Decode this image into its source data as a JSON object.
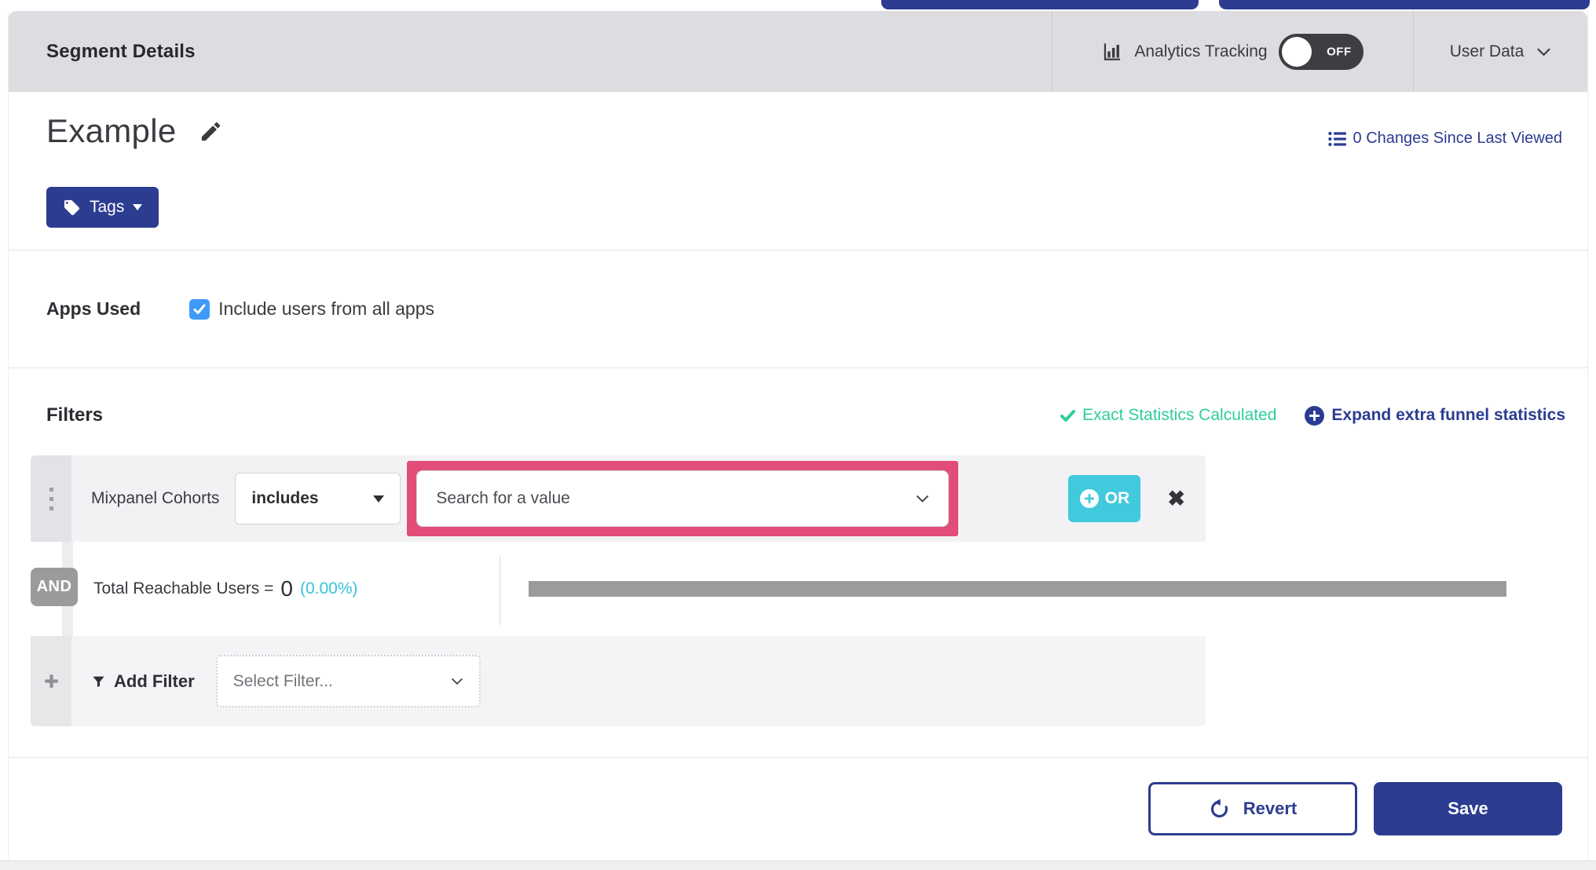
{
  "icons": {
    "close": "✖"
  },
  "header": {
    "title": "Segment Details",
    "analytics": {
      "label": "Analytics Tracking",
      "toggle_state": "OFF"
    },
    "user_data": {
      "label": "User Data"
    }
  },
  "segment": {
    "name": "Example",
    "changes_link": "0 Changes Since Last Viewed",
    "tags_button": "Tags"
  },
  "apps_used": {
    "label": "Apps Used",
    "checkbox_label": "Include users from all apps",
    "checked": true
  },
  "filters": {
    "heading": "Filters",
    "status_text": "Exact Statistics Calculated",
    "expand_link": "Expand extra funnel statistics",
    "rows": [
      {
        "field": "Mixpanel Cohorts",
        "operator": "includes",
        "value_placeholder": "Search for a value",
        "or_button": "OR"
      }
    ],
    "conjunction": "AND",
    "summary": {
      "label": "Total Reachable Users =",
      "value": "0",
      "percent": "(0.00%)"
    },
    "add_filter": {
      "label": "Add Filter",
      "placeholder": "Select Filter..."
    }
  },
  "actions": {
    "revert": "Revert",
    "save": "Save"
  },
  "colors": {
    "indigo": "#2c3c90",
    "teal_or": "#41cadd",
    "cyan_percent": "#35c4d8",
    "green_status": "#2fcd9f",
    "pink_highlight": "#e14d78",
    "checkbox_blue": "#3f9bfa",
    "progress_gray": "#9b9b9e"
  }
}
